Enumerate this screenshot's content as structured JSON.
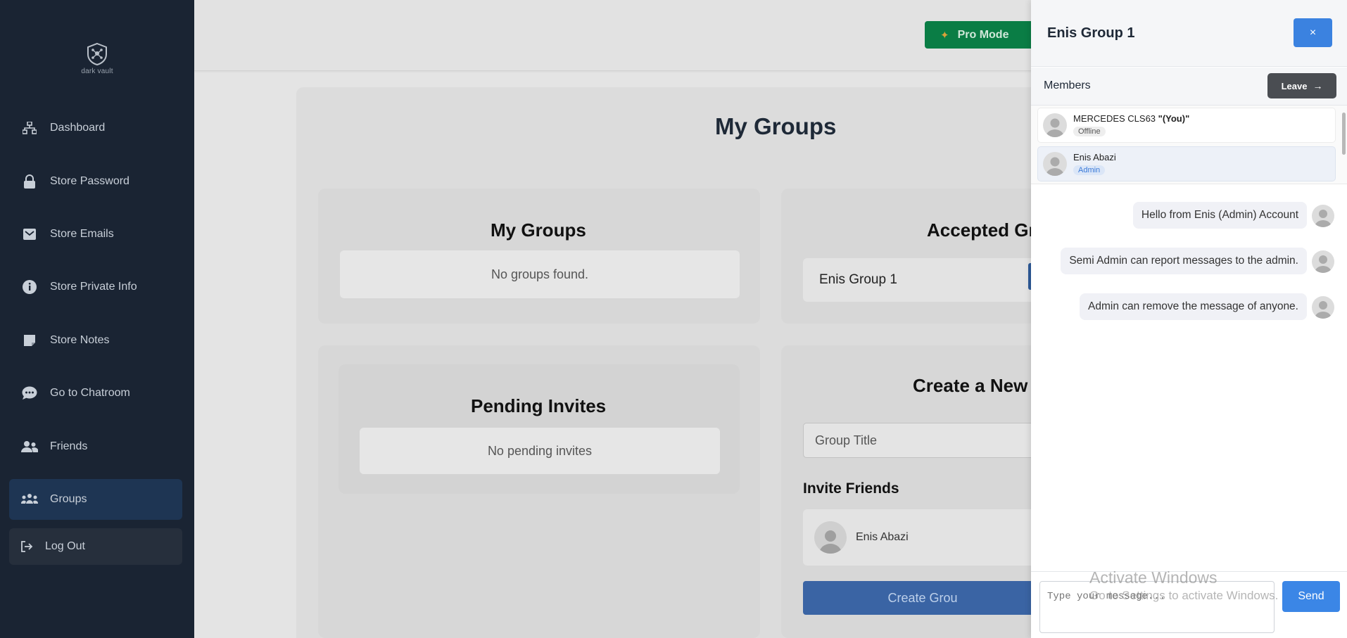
{
  "app": {
    "logo_text": "dark vault"
  },
  "sidebar": {
    "items": [
      {
        "label": "Dashboard",
        "icon": "sitemap-icon"
      },
      {
        "label": "Store Password",
        "icon": "lock-icon"
      },
      {
        "label": "Store Emails",
        "icon": "envelope-icon"
      },
      {
        "label": "Store Private Info",
        "icon": "info-icon"
      },
      {
        "label": "Store Notes",
        "icon": "note-icon"
      },
      {
        "label": "Go to Chatroom",
        "icon": "chat-icon"
      },
      {
        "label": "Friends",
        "icon": "users-icon"
      },
      {
        "label": "Groups",
        "icon": "group-icon",
        "active": true
      }
    ],
    "logout_label": "Log Out"
  },
  "topbar": {
    "pro_mode_label": "Pro Mode"
  },
  "main": {
    "title": "My Groups",
    "my_groups": {
      "title": "My Groups",
      "empty_text": "No groups found."
    },
    "accepted_groups": {
      "title": "Accepted Gr",
      "items": [
        "Enis Group 1"
      ]
    },
    "pending_invites": {
      "title": "Pending Invites",
      "empty_text": "No pending invites"
    },
    "create_group": {
      "title": "Create a New",
      "title_placeholder": "Group Title",
      "invite_label": "Invite Friends",
      "friends": [
        "Enis Abazi"
      ],
      "create_button": "Create Grou"
    }
  },
  "drawer": {
    "title": "Enis Group 1",
    "close_label": "×",
    "members_label": "Members",
    "leave_label": "Leave",
    "members": [
      {
        "name": "MERCEDES CLS63",
        "suffix": "\"(You)\"",
        "status": "Offline"
      },
      {
        "name": "Enis Abazi",
        "status": "Admin"
      }
    ],
    "messages": [
      "Hello from Enis (Admin) Account",
      "Semi Admin can report messages to the admin.",
      "Admin can remove the message of anyone."
    ],
    "input_placeholder": "Type your message...",
    "send_label": "Send"
  },
  "watermark": {
    "line1": "Activate Windows",
    "line2": "Go to Settings to activate Windows."
  },
  "colors": {
    "sidebar_bg": "#1a2433",
    "accent_blue": "#3b82e0",
    "pro_mode_green": "#0a7d45",
    "leave_dark": "#4a4d52"
  }
}
